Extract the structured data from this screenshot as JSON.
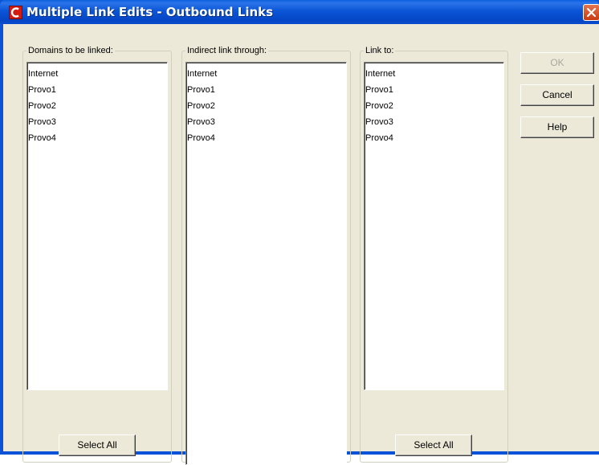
{
  "window": {
    "title": "Multiple Link Edits - Outbound Links"
  },
  "groups": [
    {
      "label": "Domains to be linked:",
      "items": [
        "Internet",
        "Provo1",
        "Provo2",
        "Provo3",
        "Provo4"
      ],
      "select_all_label": "Select All"
    },
    {
      "label": "Indirect link through:",
      "items": [
        "Internet",
        "Provo1",
        "Provo2",
        "Provo3",
        "Provo4"
      ]
    },
    {
      "label": "Link to:",
      "items": [
        "Internet",
        "Provo1",
        "Provo2",
        "Provo3",
        "Provo4"
      ],
      "select_all_label": "Select All"
    }
  ],
  "buttons": {
    "ok": {
      "label": "OK",
      "enabled": false
    },
    "cancel": {
      "label": "Cancel",
      "enabled": true
    },
    "help": {
      "label": "Help",
      "enabled": true
    }
  },
  "colors": {
    "titlebar": "#0a53d8",
    "dialog_face": "#ece9d8",
    "close_button": "#d4502a",
    "app_icon": "#d41b10"
  },
  "icons": {
    "app": "app-logo-icon",
    "close": "close-icon"
  }
}
